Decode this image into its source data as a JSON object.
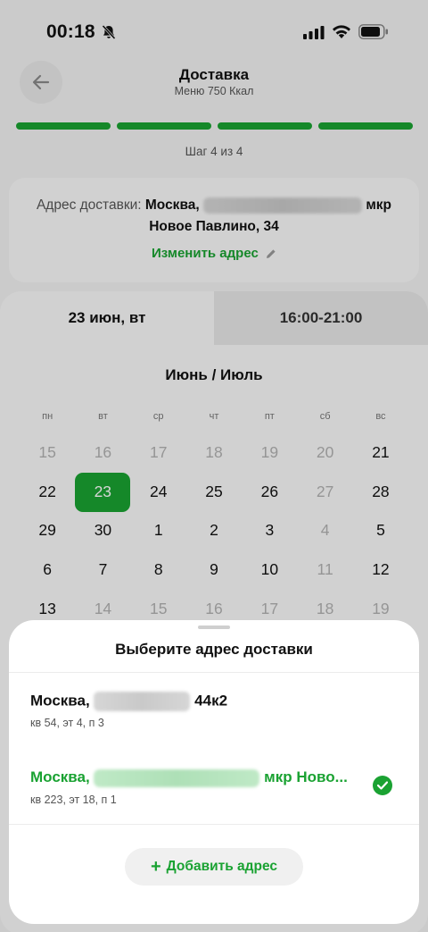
{
  "status_bar": {
    "time": "00:18"
  },
  "header": {
    "title": "Доставка",
    "subtitle": "Меню 750 Ккал"
  },
  "progress": {
    "current_step": 4,
    "total_steps": 4,
    "label": "Шаг 4 из 4"
  },
  "address_card": {
    "label": "Адрес доставки:",
    "city": "Москва,",
    "suffix": "мкр",
    "line2": "Новое Павлино, 34",
    "change_label": "Изменить адрес"
  },
  "tabs": {
    "date": "23 июн, вт",
    "time": "16:00-21:00"
  },
  "calendar": {
    "month_label": "Июнь / Июль",
    "weekdays": [
      "пн",
      "вт",
      "ср",
      "чт",
      "пт",
      "сб",
      "вс"
    ],
    "days": [
      {
        "d": "15",
        "off": true
      },
      {
        "d": "16",
        "off": true
      },
      {
        "d": "17",
        "off": true
      },
      {
        "d": "18",
        "off": true
      },
      {
        "d": "19",
        "off": true
      },
      {
        "d": "20",
        "off": true
      },
      {
        "d": "21",
        "off": false
      },
      {
        "d": "22",
        "off": false
      },
      {
        "d": "23",
        "off": false,
        "selected": true
      },
      {
        "d": "24",
        "off": false
      },
      {
        "d": "25",
        "off": false
      },
      {
        "d": "26",
        "off": false
      },
      {
        "d": "27",
        "off": true
      },
      {
        "d": "28",
        "off": false
      },
      {
        "d": "29",
        "off": false
      },
      {
        "d": "30",
        "off": false
      },
      {
        "d": "1",
        "off": false
      },
      {
        "d": "2",
        "off": false
      },
      {
        "d": "3",
        "off": false
      },
      {
        "d": "4",
        "off": true
      },
      {
        "d": "5",
        "off": false
      },
      {
        "d": "6",
        "off": false
      },
      {
        "d": "7",
        "off": false
      },
      {
        "d": "8",
        "off": false
      },
      {
        "d": "9",
        "off": false
      },
      {
        "d": "10",
        "off": false
      },
      {
        "d": "11",
        "off": true
      },
      {
        "d": "12",
        "off": false
      },
      {
        "d": "13",
        "off": false
      },
      {
        "d": "14",
        "off": true
      },
      {
        "d": "15",
        "off": true
      },
      {
        "d": "16",
        "off": true
      },
      {
        "d": "17",
        "off": true
      },
      {
        "d": "18",
        "off": true
      },
      {
        "d": "19",
        "off": true
      }
    ]
  },
  "sheet": {
    "title": "Выберите адрес доставки",
    "addresses": [
      {
        "city": "Москва,",
        "tail": "44к2",
        "details": "кв 54, эт 4, п 3",
        "selected": false
      },
      {
        "city": "Москва,",
        "tail": "мкр Ново...",
        "details": "кв 223, эт 18, п 1",
        "selected": true
      }
    ],
    "add_label": "Добавить адрес"
  },
  "colors": {
    "accent": "#1aa232"
  }
}
